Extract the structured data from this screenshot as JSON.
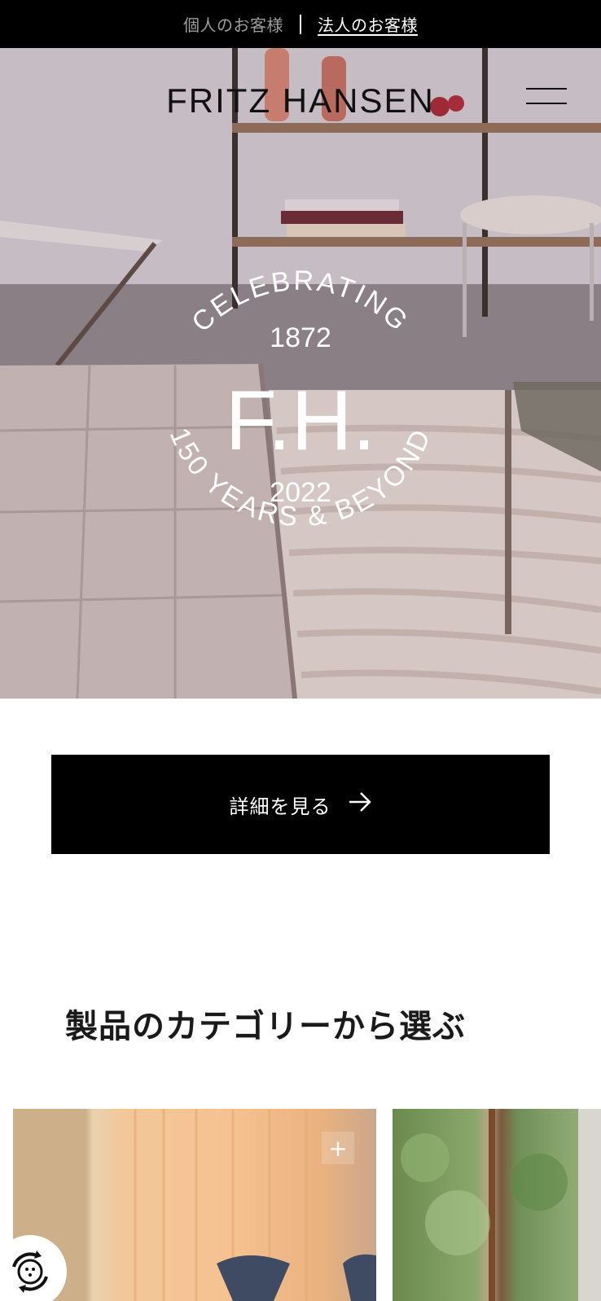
{
  "topbar": {
    "personal_label": "個人のお客様",
    "business_label": "法人のお客様"
  },
  "header": {
    "brand": "FRITZ HANSEN",
    "menu_icon": "hamburger-icon"
  },
  "hero": {
    "badge": {
      "arc_top": "CELEBRATING",
      "year_start": "1872",
      "monogram": "F.H.",
      "year_end": "2022",
      "arc_bottom": "150 YEARS & BEYOND"
    }
  },
  "cta": {
    "label": "詳細を見る",
    "icon": "arrow-right-icon"
  },
  "categories": {
    "title": "製品のカテゴリーから選ぶ",
    "plus_icon": "plus-icon"
  },
  "cookie": {
    "icon": "cookie-settings-icon"
  },
  "colors": {
    "topbar_bg": "#000000",
    "cta_bg": "#000000",
    "text_inverse": "#ffffff"
  }
}
